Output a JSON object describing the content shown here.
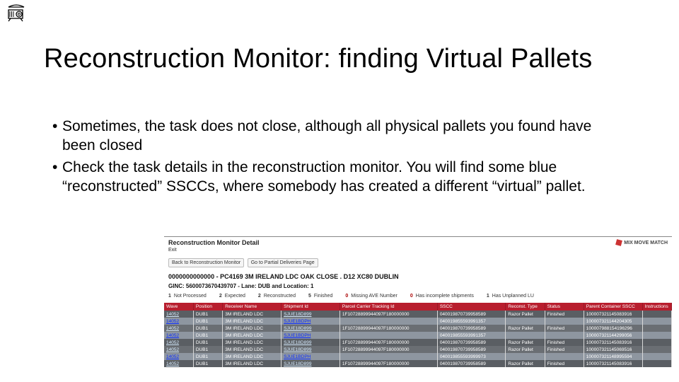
{
  "title": "Reconstruction Monitor: finding Virtual Pallets",
  "bullets": [
    "Sometimes, the task does not close, although all physical pallets you found have been closed",
    "Check the task details in the reconstruction monitor. You will find some blue “reconstructed” SSCCs, where somebody has created a different “virtual” pallet."
  ],
  "app": {
    "header_title": "Reconstruction Monitor Detail",
    "logo_text": "MIX MOVE MATCH",
    "edit_link": "Exit",
    "buttons": {
      "back": "Back to Reconstruction Monitor",
      "gotoPartial": "Go to Partial Deliveries Page"
    },
    "heading1": "0000000000000 - PC4169 3M IRELAND LDC OAK CLOSE . D12 XC80 DUBLIN",
    "heading2": "GINC: 5600073670439707 - Lane: DUB and Location: 1",
    "status": {
      "not_processed": {
        "label": "Not Processed",
        "value": "1"
      },
      "expected": {
        "label": "Expected",
        "value": "2"
      },
      "reconstructed": {
        "label": "Reconstructed",
        "value": "2"
      },
      "finished": {
        "label": "Finished",
        "value": "5"
      },
      "missing_ave": {
        "label": "Missing AVE Number",
        "value": "0"
      },
      "incomplete": {
        "label": "Has incomplete shipments",
        "value": "0"
      },
      "unplanned": {
        "label": "Has Unplanned LU",
        "value": "1"
      }
    },
    "columns": {
      "wave": "Wave",
      "position": "Position",
      "receiver": "Receiver Name",
      "shipment": "Shipment Id",
      "tracking": "Parcel Carrier Tracking Id",
      "sscc": "SSCC",
      "reconst_type": "Reconst. Type",
      "status": "Status",
      "parent": "Parent Container SSCC",
      "instructions": "Instructions"
    },
    "rows": [
      {
        "cls": "grey",
        "wave": "14052",
        "pos": "DUB1",
        "rec": "3M IRELAND LDC",
        "ship": "SJUE18D899",
        "track": "1F10728899944097F180000000",
        "sscc": "040019870739958589",
        "rtype": "Razor Pallet",
        "status": "Finished",
        "parent": "100007321145083916",
        "instr": ""
      },
      {
        "cls": "blue",
        "wave": "14052",
        "pos": "DUB1",
        "rec": "3M IRELAND LDC",
        "ship": "SJUE1BDPH",
        "track": "",
        "sscc": "040019855593991357",
        "rtype": "",
        "status": "",
        "parent": "100007321144204305",
        "instr": ""
      },
      {
        "cls": "grey2",
        "wave": "14052",
        "pos": "DUB1",
        "rec": "3M IRELAND LDC",
        "ship": "SJUE18D899",
        "track": "1F10728899944097F180000000",
        "sscc": "040019870739958589",
        "rtype": "Razor Pallet",
        "status": "Finished",
        "parent": "100007988154196296",
        "instr": ""
      },
      {
        "cls": "blue",
        "wave": "14052",
        "pos": "DUB1",
        "rec": "3M IRELAND LDC",
        "ship": "SJUE1BDPH",
        "track": "",
        "sscc": "040019855593991357",
        "rtype": "",
        "status": "",
        "parent": "100007321144299056",
        "instr": ""
      },
      {
        "cls": "grey",
        "wave": "14052",
        "pos": "DUB1",
        "rec": "3M IRELAND LDC",
        "ship": "SJUE18D899",
        "track": "1F10728899944097F180000000",
        "sscc": "040019870739958589",
        "rtype": "Razor Pallet",
        "status": "Finished",
        "parent": "100007321145083916",
        "instr": ""
      },
      {
        "cls": "grey2",
        "wave": "14052",
        "pos": "DUB1",
        "rec": "3M IRELAND LDC",
        "ship": "SJUE18D899",
        "track": "1F10728899944097F180000000",
        "sscc": "040019870739958589",
        "rtype": "Razor Pallet",
        "status": "Finished",
        "parent": "100007321145069516",
        "instr": ""
      },
      {
        "cls": "blue",
        "wave": "14052",
        "pos": "DUB1",
        "rec": "3M IRELAND LDC",
        "ship": "SJUE1BDPH",
        "track": "",
        "sscc": "040019855593999973",
        "rtype": "",
        "status": "",
        "parent": "100007321148995594",
        "instr": ""
      },
      {
        "cls": "grey",
        "wave": "14052",
        "pos": "DUB1",
        "rec": "3M IRELAND LDC",
        "ship": "SJUE18D899",
        "track": "1F10728899944097F180000000",
        "sscc": "040019870739958589",
        "rtype": "Razor Pallet",
        "status": "Finished",
        "parent": "100007321145083916",
        "instr": ""
      }
    ]
  }
}
